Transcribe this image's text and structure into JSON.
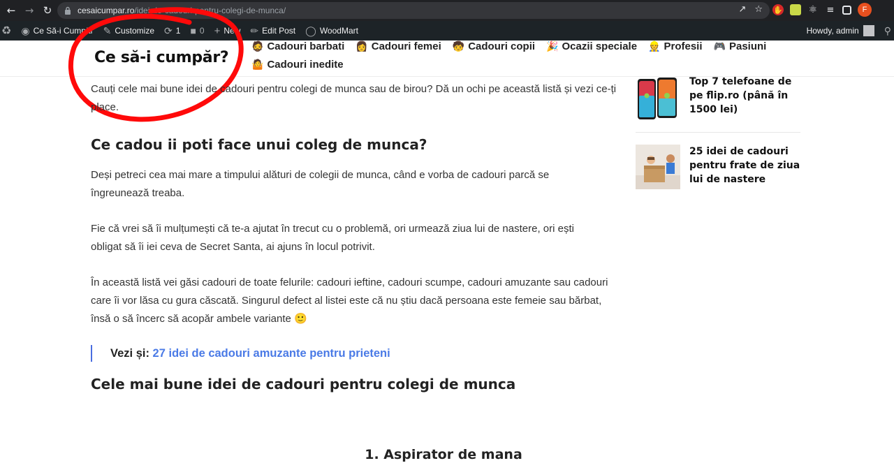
{
  "browser": {
    "url_host": "cesaicumpar.ro",
    "url_path": "/idei-de-cadouri-pentru-colegi-de-munca/",
    "profile_initial": "F"
  },
  "adminbar": {
    "site_name": "Ce Să-i Cumpăr",
    "customize": "Customize",
    "updates": "1",
    "comments": "0",
    "new": "New",
    "edit_post": "Edit Post",
    "woodmart": "WoodMart",
    "howdy": "Howdy, admin"
  },
  "header": {
    "logo": "Ce să-i cumpăr?",
    "menu": [
      {
        "icon": "🧔",
        "label": "Cadouri barbati"
      },
      {
        "icon": "👩",
        "label": "Cadouri femei"
      },
      {
        "icon": "🧒",
        "label": "Cadouri copii"
      },
      {
        "icon": "🎉",
        "label": "Ocazii speciale"
      },
      {
        "icon": "👷",
        "label": "Profesii"
      },
      {
        "icon": "🎮",
        "label": "Pasiuni"
      },
      {
        "icon": "🤷",
        "label": "Cadouri inedite"
      }
    ]
  },
  "article": {
    "intro": "Cauți cele mai bune idei de cadouri pentru colegi de munca sau de birou? Dă un ochi pe această listă și vezi ce-ți place.",
    "h2_1": "Ce cadou ii poti face unui coleg de munca?",
    "p1": "Deși petreci cea mai mare a timpului alături de colegii de munca, când e vorba de cadouri parcă se îngreunează treaba.",
    "p2": "Fie că vrei să îi mulțumești că te-a ajutat în trecut cu o problemă, ori urmează ziua lui de nastere, ori ești obligat să îi iei ceva de Secret Santa, ai ajuns în locul potrivit.",
    "p3": "În această listă vei găsi cadouri de toate felurile: cadouri ieftine, cadouri scumpe, cadouri amuzante sau cadouri care îi vor lăsa cu gura căscată. Singurul defect al listei este că nu știu dacă persoana este femeie sau bărbat, însă o să încerc să acopăr ambele variante",
    "p3_emoji": "🙂",
    "see_also_label": "Vezi și:",
    "see_also_link": "27 idei de cadouri amuzante pentru prieteni",
    "h2_2": "Cele mai bune idei de cadouri pentru colegi de munca",
    "h3_1": "1. Aspirator de mana"
  },
  "sidebar": {
    "posts": [
      {
        "title": "Top 7 telefoane de pe flip.ro (până în 1500 lei)"
      },
      {
        "title": "25 idei de cadouri pentru frate de ziua lui de nastere"
      }
    ]
  }
}
